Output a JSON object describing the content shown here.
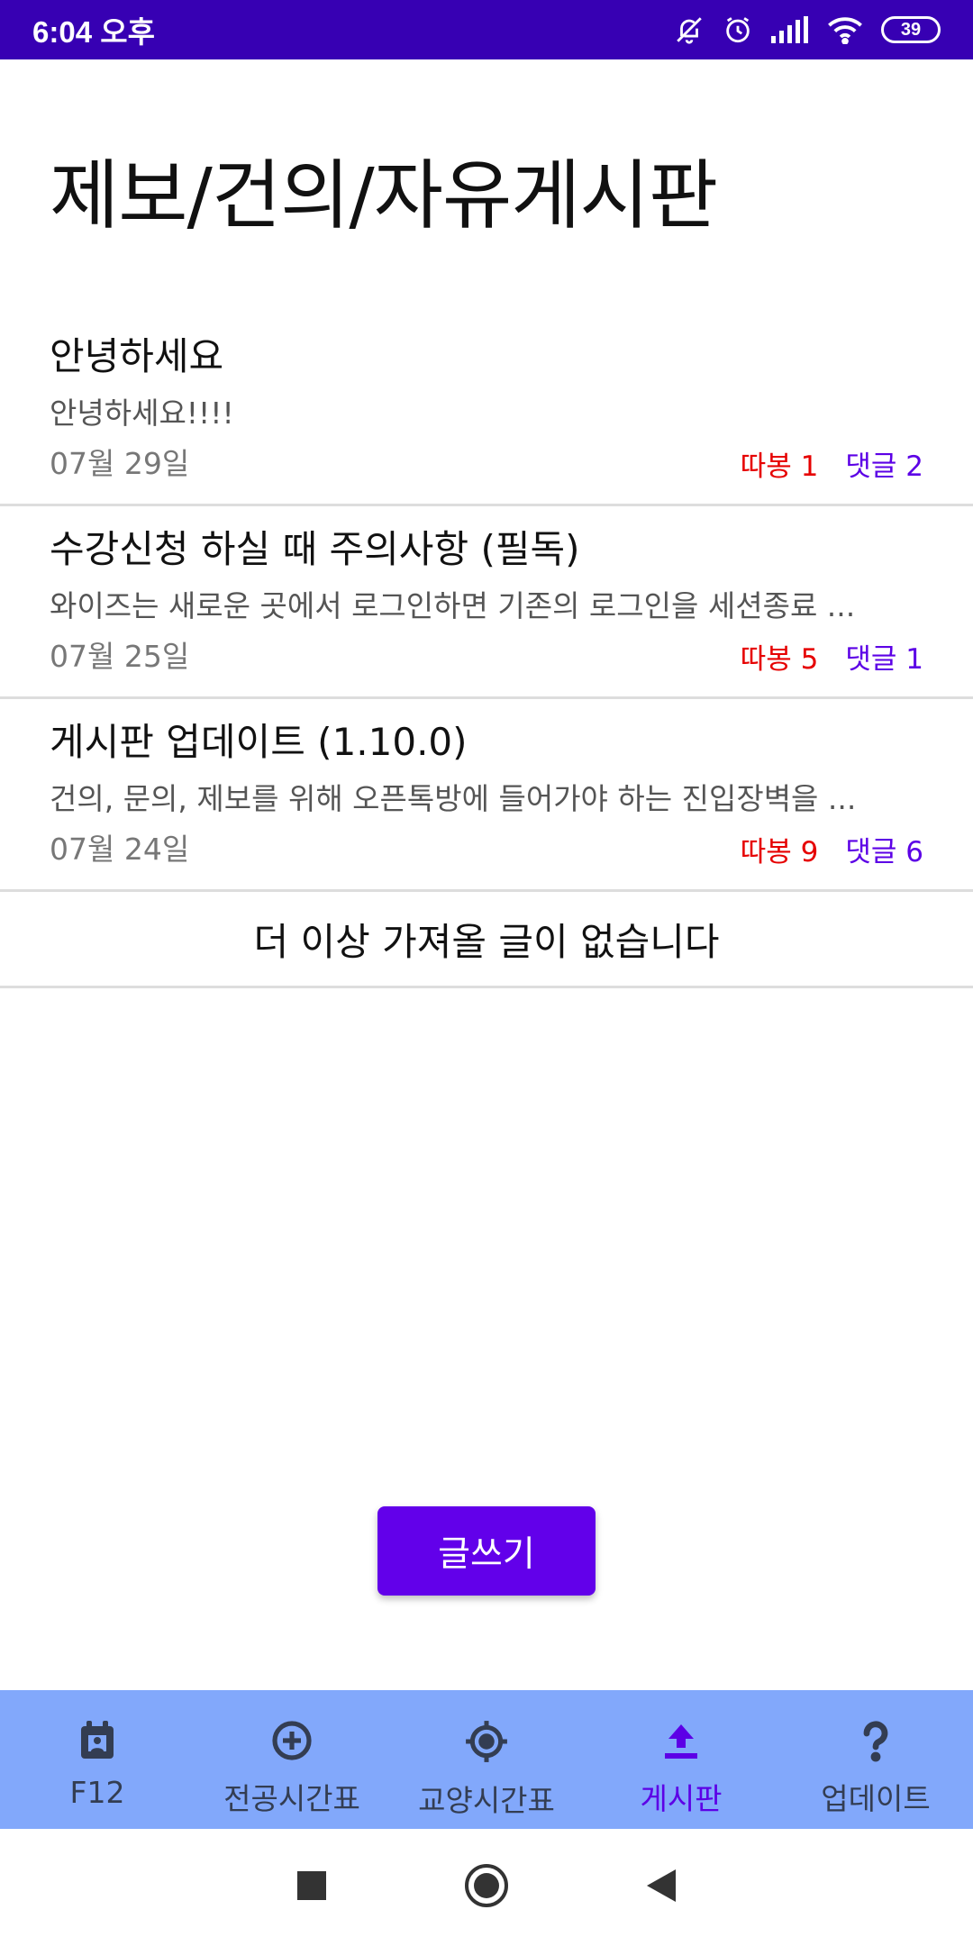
{
  "status_bar": {
    "time": "6:04 오후",
    "battery": "39",
    "icons": [
      "mute-bell-icon",
      "alarm-icon",
      "signal-icon",
      "wifi-icon",
      "battery-icon"
    ]
  },
  "page": {
    "title": "제보/건의/자유게시판"
  },
  "posts": [
    {
      "title": "안녕하세요",
      "preview": "안녕하세요!!!!",
      "date": "07월 29일",
      "ttabong": "따봉 1",
      "comments": "댓글 2"
    },
    {
      "title": "수강신청 하실 때 주의사항 (필독)",
      "preview": "와이즈는 새로운 곳에서 로그인하면 기존의 로그인을 세션종료 ...",
      "date": "07월 25일",
      "ttabong": "따봉 5",
      "comments": "댓글 1"
    },
    {
      "title": "게시판 업데이트 (1.10.0)",
      "preview": "건의, 문의, 제보를 위해 오픈톡방에 들어가야 하는 진입장벽을 ...",
      "date": "07월 24일",
      "ttabong": "따봉 9",
      "comments": "댓글 6"
    }
  ],
  "list_end_text": "더 이상 가져올 글이 없습니다",
  "write_button": "글쓰기",
  "bottom_nav": [
    {
      "label": "F12",
      "icon": "calendar-icon",
      "active": false
    },
    {
      "label": "전공시간표",
      "icon": "add-circle-icon",
      "active": false
    },
    {
      "label": "교양시간표",
      "icon": "crosshair-icon",
      "active": false
    },
    {
      "label": "게시판",
      "icon": "upload-icon",
      "active": true
    },
    {
      "label": "업데이트",
      "icon": "question-icon",
      "active": false
    }
  ],
  "colors": {
    "status_bar": "#3700b3",
    "accent": "#6200ea",
    "nav_background": "#82a8fb",
    "ttabong": "#e60000",
    "comments": "#5c00e6"
  }
}
